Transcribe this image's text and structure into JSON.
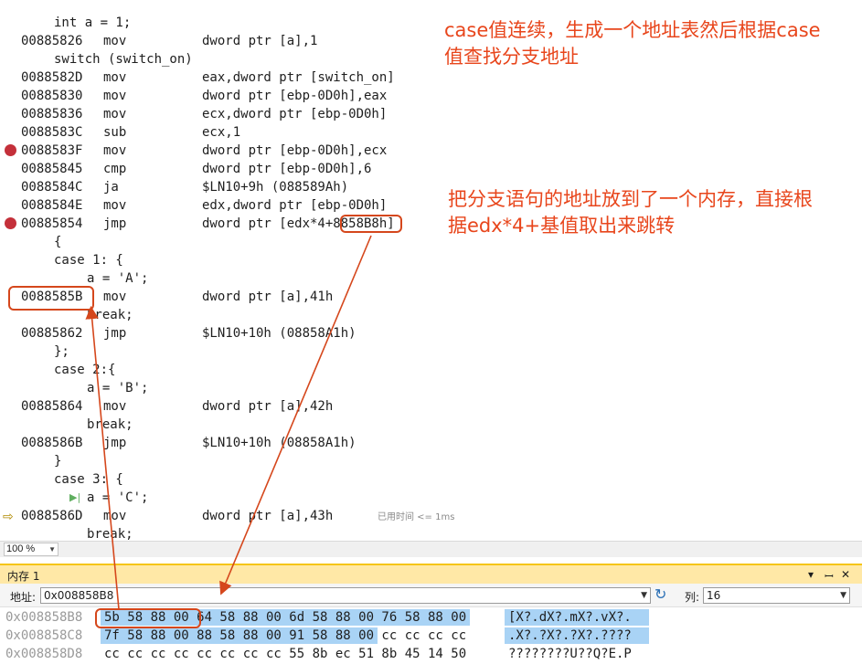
{
  "disassembly": {
    "lines": [
      {
        "kind": "src",
        "indent": 1,
        "text": "int a = 1;"
      },
      {
        "kind": "asm",
        "addr": "00885826",
        "op": "mov",
        "args": "dword ptr [a],1"
      },
      {
        "kind": "src",
        "indent": 1,
        "text": "switch (switch_on)"
      },
      {
        "kind": "asm",
        "addr": "0088582D",
        "op": "mov",
        "args": "eax,dword ptr [switch_on]"
      },
      {
        "kind": "asm",
        "addr": "00885830",
        "op": "mov",
        "args": "dword ptr [ebp-0D0h],eax"
      },
      {
        "kind": "asm",
        "addr": "00885836",
        "op": "mov",
        "args": "ecx,dword ptr [ebp-0D0h]"
      },
      {
        "kind": "asm",
        "addr": "0088583C",
        "op": "sub",
        "args": "ecx,1"
      },
      {
        "kind": "asm",
        "addr": "0088583F",
        "op": "mov",
        "args": "dword ptr [ebp-0D0h],ecx",
        "breakpoint": true
      },
      {
        "kind": "asm",
        "addr": "00885845",
        "op": "cmp",
        "args": "dword ptr [ebp-0D0h],6"
      },
      {
        "kind": "asm",
        "addr": "0088584C",
        "op": "ja",
        "args": "$LN10+9h (088589Ah)"
      },
      {
        "kind": "asm",
        "addr": "0088584E",
        "op": "mov",
        "args": "edx,dword ptr [ebp-0D0h]"
      },
      {
        "kind": "asm",
        "addr": "00885854",
        "op": "jmp",
        "args": "dword ptr [edx*4+8858B8h]",
        "breakpoint": true
      },
      {
        "kind": "src",
        "indent": 1,
        "text": "{"
      },
      {
        "kind": "src",
        "indent": 1,
        "text": "case 1: {"
      },
      {
        "kind": "src",
        "indent": 2,
        "text": "a = 'A';"
      },
      {
        "kind": "asm",
        "addr": "0088585B",
        "op": "mov",
        "args": "dword ptr [a],41h"
      },
      {
        "kind": "src",
        "indent": 2,
        "text": "break;"
      },
      {
        "kind": "asm",
        "addr": "00885862",
        "op": "jmp",
        "args": "$LN10+10h (08858A1h)"
      },
      {
        "kind": "src",
        "indent": 1,
        "text": "};"
      },
      {
        "kind": "src",
        "indent": 1,
        "text": "case 2:{"
      },
      {
        "kind": "src",
        "indent": 2,
        "text": "a = 'B';"
      },
      {
        "kind": "asm",
        "addr": "00885864",
        "op": "mov",
        "args": "dword ptr [a],42h"
      },
      {
        "kind": "src",
        "indent": 2,
        "text": "break;"
      },
      {
        "kind": "asm",
        "addr": "0088586B",
        "op": "jmp",
        "args": "$LN10+10h (08858A1h)"
      },
      {
        "kind": "src",
        "indent": 1,
        "text": "}"
      },
      {
        "kind": "src",
        "indent": 1,
        "text": "case 3: {"
      },
      {
        "kind": "src",
        "indent": 2,
        "text": "a = 'C';",
        "step_glyph": true
      },
      {
        "kind": "asm",
        "addr": "0088586D",
        "op": "mov",
        "args": "dword ptr [a],43h",
        "current": true,
        "elapsed": "已用时间 <= 1ms"
      },
      {
        "kind": "src",
        "indent": 2,
        "text": "break;"
      }
    ]
  },
  "annotations": {
    "top_note_line1": "case值连续，生成一个地址表然后根据case",
    "top_note_line2": "值查找分支地址",
    "mid_note_line1": "把分支语句的地址放到了一个内存，直接根",
    "mid_note_line2": "据edx*4+基值取出来跳转"
  },
  "zoom": {
    "value": "100 %"
  },
  "memory": {
    "title": "内存 1",
    "controls": {
      "dropdown": "▾",
      "pin": "ꟷ",
      "close": "✕"
    },
    "address_label": "地址:",
    "address_value": "0x008858B8",
    "columns_label": "列:",
    "columns_value": "16",
    "rows": [
      {
        "addr": "0x008858B8",
        "hex": "5b 58 88 00 64 58 88 00 6d 58 88 00 76 58 88 00",
        "ascii": "[X?.dX?.mX?.vX?.",
        "hex_sel_end": 16,
        "ascii_sel": true
      },
      {
        "addr": "0x008858C8",
        "hex": "7f 58 88 00 88 58 88 00 91 58 88 00 cc cc cc cc",
        "ascii": ".X?.?X?.?X?.????",
        "hex_sel_end": 12,
        "ascii_sel": true
      },
      {
        "addr": "0x008858D8",
        "hex": "cc cc cc cc cc cc cc cc 55 8b ec 51 8b 45 14 50",
        "ascii": "????????U??Q?E.P",
        "hex_sel_end": 0,
        "ascii_sel": false
      }
    ]
  },
  "colors": {
    "annotation": "#e8461c",
    "breakpoint": "#c4303a",
    "selection": "#a9d3f5",
    "memory_title_bg": "#ffe8a6"
  }
}
